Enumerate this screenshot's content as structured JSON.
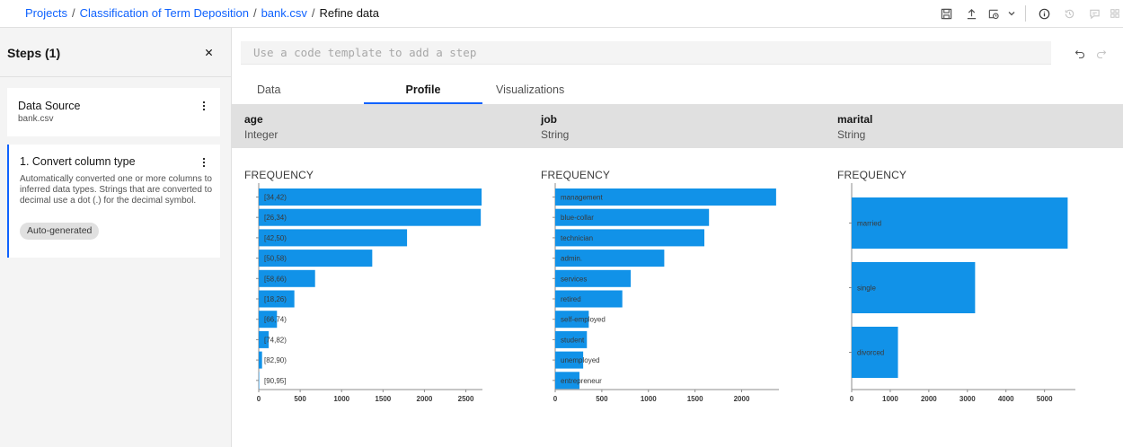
{
  "breadcrumb": {
    "items": [
      "Projects",
      "Classification of Term Deposition",
      "bank.csv"
    ],
    "current": "Refine data"
  },
  "toolbar": {
    "icons": [
      "save-icon",
      "upload-icon",
      "schedule-icon",
      "chevron-down-icon",
      "info-icon",
      "history-icon",
      "comment-icon",
      "settings-icon"
    ]
  },
  "steps": {
    "title": "Steps (1)",
    "close_glyph": "×",
    "source": {
      "title": "Data Source",
      "subtitle": "bank.csv"
    },
    "convert": {
      "title": "1. Convert column type",
      "description": "Automatically converted one or more columns to inferred data types. Strings that are converted to decimal use a dot (.) for the decimal symbol.",
      "tag": "Auto-generated"
    }
  },
  "code_template": {
    "placeholder": "Use a code template to add a step"
  },
  "tabs": [
    {
      "label": "Data"
    },
    {
      "label": "Profile",
      "active": true
    },
    {
      "label": "Visualizations"
    }
  ],
  "columns": [
    {
      "name": "age",
      "type": "Integer"
    },
    {
      "name": "job",
      "type": "String"
    },
    {
      "name": "marital",
      "type": "String"
    }
  ],
  "frequency_label": "FREQUENCY",
  "colors": {
    "bar": "#1192e8",
    "accent": "#0f62fe"
  },
  "chart_data": [
    {
      "type": "bar",
      "orientation": "horizontal",
      "title": "FREQUENCY",
      "categories": [
        "[34,42)",
        "[26,34)",
        "[42,50)",
        "[50,58)",
        "[58,66)",
        "[18,26)",
        "[66,74)",
        "[74,82)",
        "[82,90)",
        "[90,95]"
      ],
      "values": [
        2690,
        2680,
        1790,
        1370,
        680,
        430,
        220,
        120,
        40,
        5
      ],
      "xlim": [
        0,
        2700
      ],
      "xticks": [
        0,
        500,
        1000,
        1500,
        2000,
        2500
      ]
    },
    {
      "type": "bar",
      "orientation": "horizontal",
      "title": "FREQUENCY",
      "categories": [
        "management",
        "blue-collar",
        "technician",
        "admin.",
        "services",
        "retired",
        "self-employed",
        "student",
        "unemployed",
        "entrepreneur"
      ],
      "values": [
        2370,
        1650,
        1600,
        1170,
        810,
        720,
        360,
        340,
        300,
        260
      ],
      "xlim": [
        0,
        2400
      ],
      "xticks": [
        0,
        500,
        1000,
        1500,
        2000
      ]
    },
    {
      "type": "bar",
      "orientation": "horizontal",
      "title": "FREQUENCY",
      "categories": [
        "married",
        "single",
        "divorced"
      ],
      "values": [
        5600,
        3200,
        1200
      ],
      "xlim": [
        0,
        5800
      ],
      "xticks": [
        0,
        1000,
        2000,
        3000,
        4000,
        5000
      ]
    }
  ]
}
